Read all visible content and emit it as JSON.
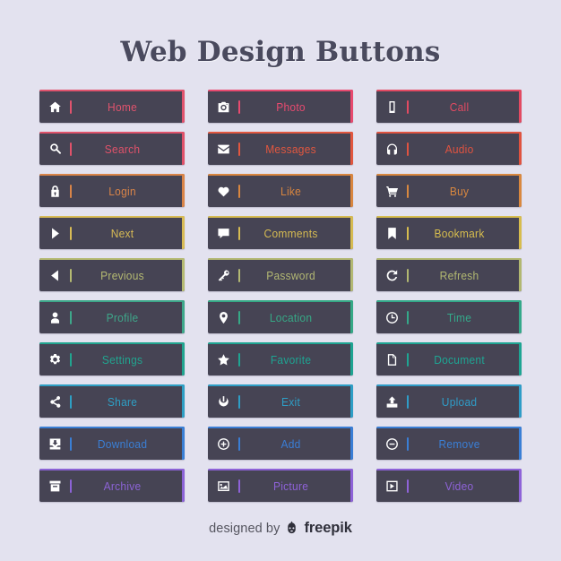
{
  "page": {
    "title": "Web Design Buttons",
    "background_color": "#e3e2ef",
    "button_bg_color": "#464454"
  },
  "buttons": [
    {
      "label": "Home",
      "icon": "home-icon",
      "color": "#e0536d"
    },
    {
      "label": "Photo",
      "icon": "camera-icon",
      "color": "#e84a6f"
    },
    {
      "label": "Call",
      "icon": "mobile-icon",
      "color": "#e34a62"
    },
    {
      "label": "Search",
      "icon": "search-icon",
      "color": "#e0526a"
    },
    {
      "label": "Messages",
      "icon": "envelope-icon",
      "color": "#e2573f"
    },
    {
      "label": "Audio",
      "icon": "headphones-icon",
      "color": "#e05340"
    },
    {
      "label": "Login",
      "icon": "lock-icon",
      "color": "#d98448"
    },
    {
      "label": "Like",
      "icon": "heart-icon",
      "color": "#d9863f"
    },
    {
      "label": "Buy",
      "icon": "cart-icon",
      "color": "#d9883f"
    },
    {
      "label": "Next",
      "icon": "play-arrow-icon",
      "color": "#d8bb55"
    },
    {
      "label": "Comments",
      "icon": "comment-icon",
      "color": "#d6bb52"
    },
    {
      "label": "Bookmark",
      "icon": "bookmark-icon",
      "color": "#d7bd4e"
    },
    {
      "label": "Previous",
      "icon": "back-arrow-icon",
      "color": "#b5ba72"
    },
    {
      "label": "Password",
      "icon": "key-icon",
      "color": "#b3b873"
    },
    {
      "label": "Refresh",
      "icon": "refresh-icon",
      "color": "#b2b871"
    },
    {
      "label": "Profile",
      "icon": "user-icon",
      "color": "#3ea78a"
    },
    {
      "label": "Location",
      "icon": "map-pin-icon",
      "color": "#36a986"
    },
    {
      "label": "Time",
      "icon": "clock-icon",
      "color": "#34a98a"
    },
    {
      "label": "Settings",
      "icon": "gear-icon",
      "color": "#21a48f"
    },
    {
      "label": "Favorite",
      "icon": "star-icon",
      "color": "#1ea492"
    },
    {
      "label": "Document",
      "icon": "document-icon",
      "color": "#1ea593"
    },
    {
      "label": "Share",
      "icon": "share-icon",
      "color": "#2e9fc4"
    },
    {
      "label": "Exit",
      "icon": "power-icon",
      "color": "#2e9ec6"
    },
    {
      "label": "Upload",
      "icon": "upload-icon",
      "color": "#2f9dc8"
    },
    {
      "label": "Download",
      "icon": "download-icon",
      "color": "#3a7fd5"
    },
    {
      "label": "Add",
      "icon": "plus-circle-icon",
      "color": "#3a7ed6"
    },
    {
      "label": "Remove",
      "icon": "minus-circle-icon",
      "color": "#3a7fd6"
    },
    {
      "label": "Archive",
      "icon": "archive-icon",
      "color": "#8c63d6"
    },
    {
      "label": "Picture",
      "icon": "picture-icon",
      "color": "#8e62d8"
    },
    {
      "label": "Video",
      "icon": "video-icon",
      "color": "#8f63d9"
    }
  ],
  "footer": {
    "designed_by": "designed by",
    "brand": "freepik",
    "logo_icon": "freepik-robot-icon"
  }
}
